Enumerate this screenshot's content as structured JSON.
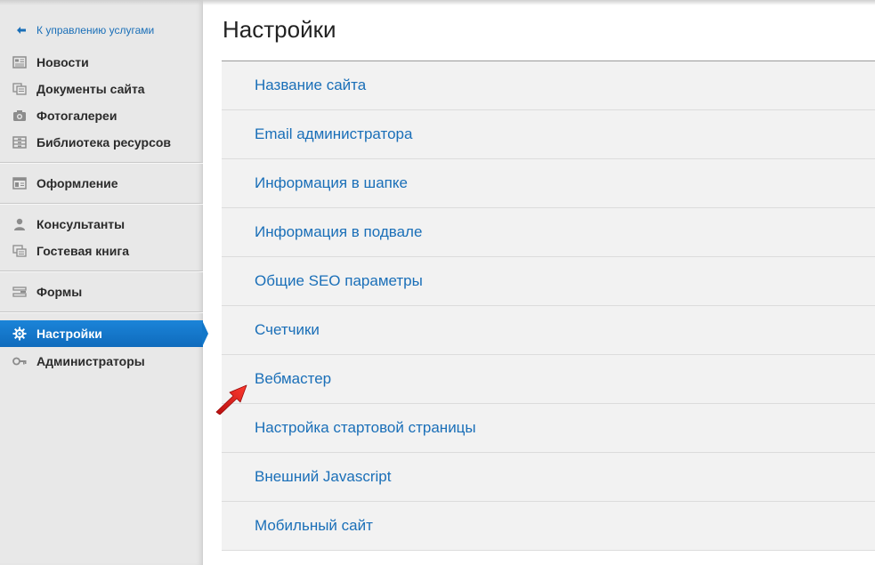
{
  "sidebar": {
    "back_link": "К управлению услугами",
    "items": [
      {
        "label": "Новости",
        "icon": "news-icon"
      },
      {
        "label": "Документы сайта",
        "icon": "documents-icon"
      },
      {
        "label": "Фотогалереи",
        "icon": "camera-icon"
      },
      {
        "label": "Библиотека ресурсов",
        "icon": "library-icon"
      },
      {
        "label": "Оформление",
        "icon": "layout-icon"
      },
      {
        "label": "Консультанты",
        "icon": "user-icon"
      },
      {
        "label": "Гостевая книга",
        "icon": "guestbook-icon"
      },
      {
        "label": "Формы",
        "icon": "forms-icon"
      },
      {
        "label": "Настройки",
        "icon": "gear-icon",
        "active": true
      },
      {
        "label": "Администраторы",
        "icon": "key-icon"
      }
    ]
  },
  "main": {
    "title": "Настройки",
    "settings": [
      "Название сайта",
      "Email администратора",
      "Информация в шапке",
      "Информация в подвале",
      "Общие SEO параметры",
      "Счетчики",
      "Вебмастер",
      "Настройка стартовой страницы",
      "Внешний Javascript",
      "Мобильный сайт"
    ]
  },
  "colors": {
    "accent": "#1277c9",
    "link": "#1a6fb8",
    "sidebar_bg": "#e8e8e8",
    "list_bg": "#f2f2f2",
    "annotation_arrow": "#e21b1b"
  }
}
